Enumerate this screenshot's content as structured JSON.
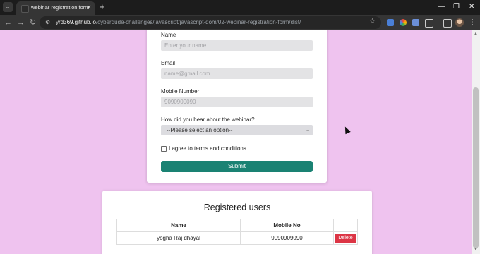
{
  "browser": {
    "tab_title": "webinar registration form",
    "url_host": "yrd369.github.io",
    "url_path": "/cyberdude-challenges/javascript/javascript-dom/02-webinar-registration-form/dist/"
  },
  "form": {
    "name_label": "Name",
    "name_placeholder": "Enter your name",
    "email_label": "Email",
    "email_placeholder": "name@gmail.com",
    "mobile_label": "Mobile Number",
    "mobile_placeholder": "9090909090",
    "source_label": "How did you hear about the webinar?",
    "source_selected": "--Please select an option--",
    "terms_label": "I agree to terms and conditions.",
    "submit_label": "Submit"
  },
  "registered": {
    "title": "Registered users",
    "columns": [
      "Name",
      "Mobile No",
      ""
    ],
    "rows": [
      {
        "name": "yogha Raj dhayal",
        "mobile": "9090909090",
        "action": "Delete"
      }
    ]
  }
}
